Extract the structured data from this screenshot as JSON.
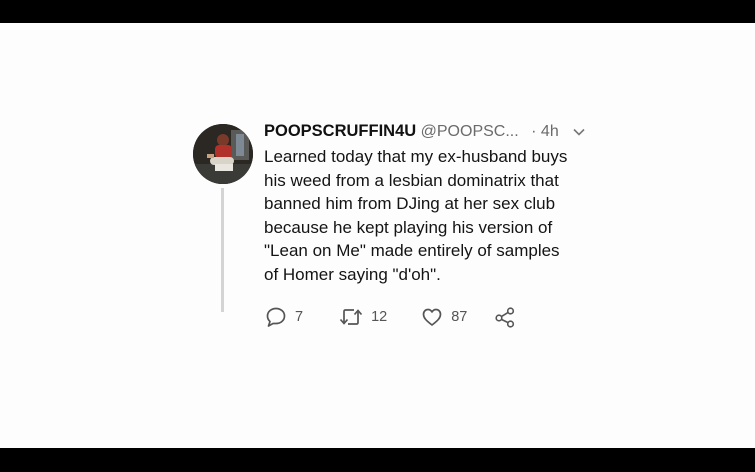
{
  "tweet": {
    "display_name": "POOPSCRUFFIN4U",
    "handle": "@POOPSC...",
    "time": "· 4h",
    "text": "Learned today that my ex-husband buys\nhis weed from a lesbian dominatrix that\nbanned him from DJing at her sex club\nbecause he kept playing his version of\n\"Lean on Me\" made entirely of samples\nof Homer saying \"d'oh\".",
    "replies": "7",
    "retweets": "12",
    "likes": "87"
  },
  "icons": {
    "avatar": "user-avatar",
    "caret": "chevron-down-icon",
    "reply": "reply-icon",
    "retweet": "retweet-icon",
    "like": "heart-icon",
    "share": "share-icon"
  },
  "colors": {
    "text": "#141414",
    "muted": "#6b6b6b",
    "icon": "#555555",
    "background": "#fdfdfd",
    "letterbox": "#000000"
  }
}
